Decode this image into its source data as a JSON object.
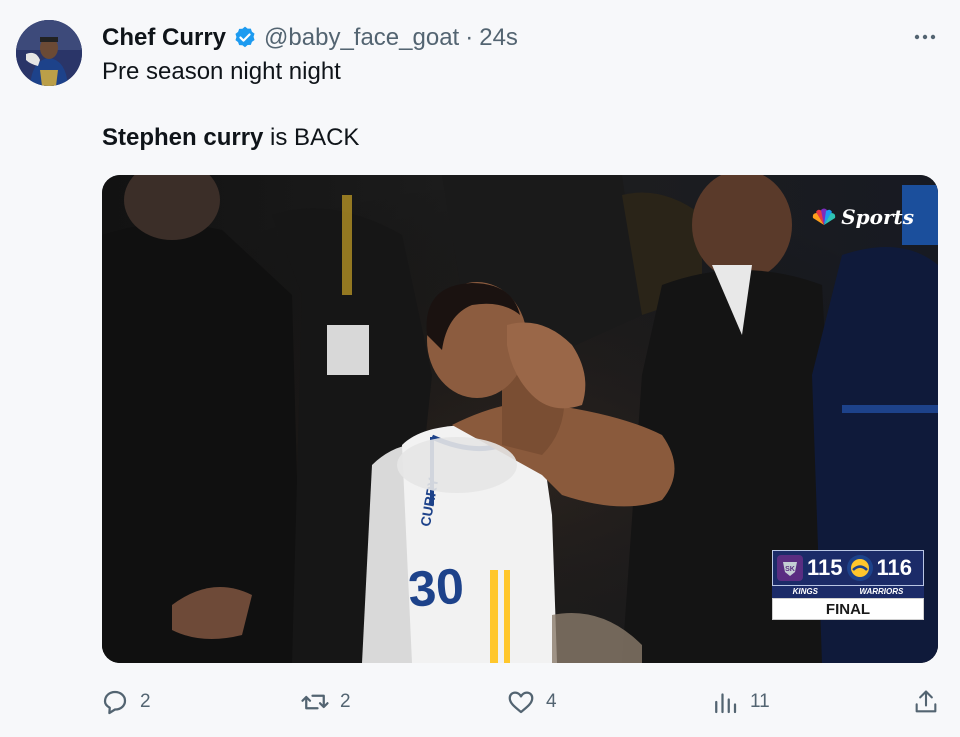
{
  "user": {
    "display_name": "Chef Curry",
    "handle": "@baby_face_goat",
    "separator": "·",
    "time": "24s"
  },
  "tweet": {
    "line1": "Pre season night night",
    "line2_bold": "Stephen curry",
    "line2_rest": " is BACK"
  },
  "media": {
    "network_logo": "Sports",
    "scoreboard": {
      "home_score": "115",
      "away_score": "116",
      "home_team": "KINGS",
      "away_team": "WARRIORS",
      "status": "FINAL"
    },
    "jersey_number": "30"
  },
  "actions": {
    "replies": "2",
    "retweets": "2",
    "likes": "4",
    "views": "11"
  },
  "icons": {
    "verified": "verified-badge-icon",
    "more": "more-horizontal-icon",
    "reply": "reply-icon",
    "retweet": "retweet-icon",
    "like": "heart-icon",
    "views": "views-chart-icon",
    "share": "share-icon"
  },
  "colors": {
    "verified_blue": "#1d9bf0",
    "text_primary": "#0f1419",
    "text_secondary": "#536471",
    "kings_purple": "#5a2d81",
    "warriors_blue": "#1d428a",
    "warriors_gold": "#ffc72c"
  }
}
